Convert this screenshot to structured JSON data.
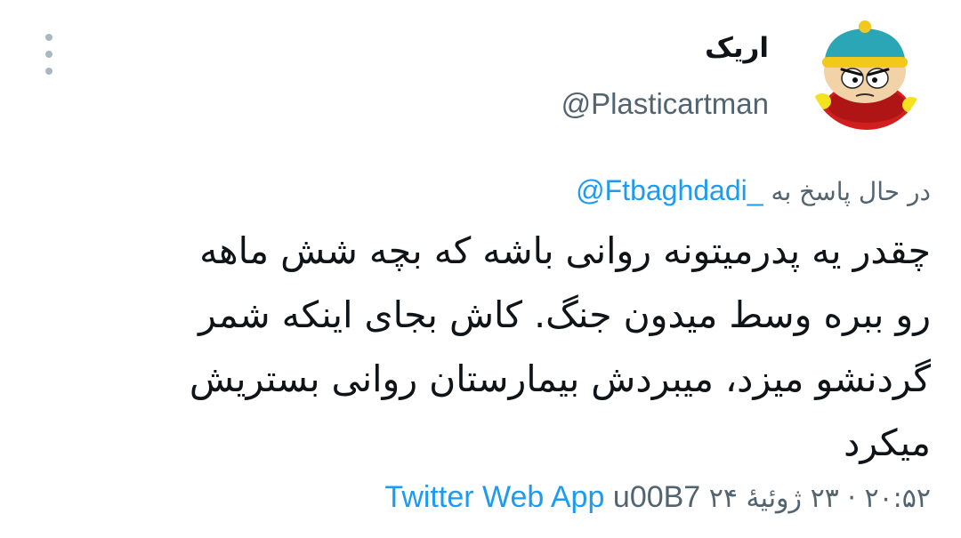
{
  "tweet": {
    "author": {
      "display_name": "اریک",
      "handle": "@Plasticartman",
      "avatar": "cartman-avatar"
    },
    "reply": {
      "prefix": "در حال پاسخ به",
      "mention": "@Ftbaghdadi_"
    },
    "body_lines": [
      "چقدر یه پدرمیتونه روانی باشه که بچه شش ماهه",
      "رو ببره وسط میدون جنگ. کاش بجای اینکه شمر",
      "گردنشو میزد، میبردش بیمارستان روانی بستریش",
      "میکرد"
    ],
    "meta": {
      "time": "۲۰:۵۲",
      "separator": "·",
      "date": "۲۳ ژوئیهٔ ۲۴",
      "code": "u00B7",
      "source": "Twitter Web App"
    },
    "more_icon": "more-vertical-icon"
  }
}
